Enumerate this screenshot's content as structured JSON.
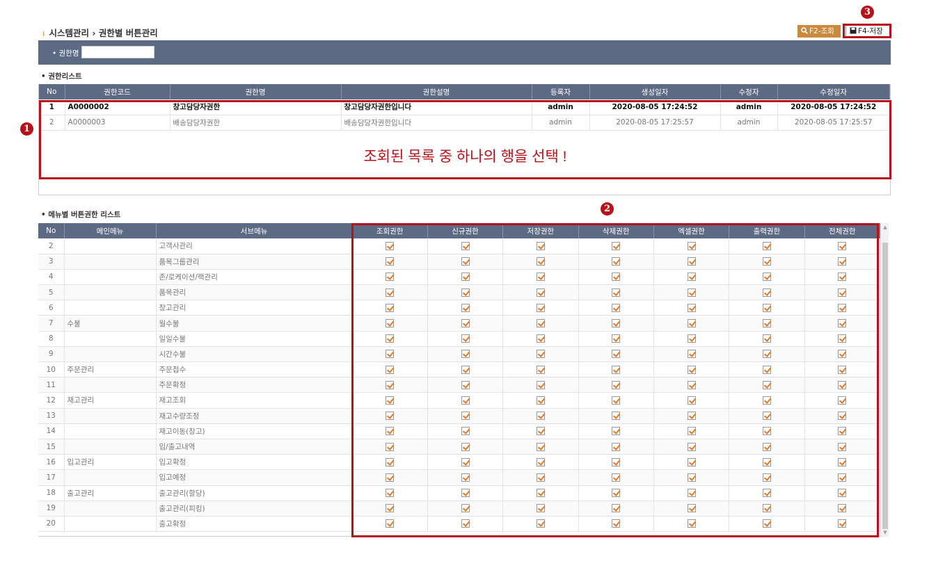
{
  "header": {
    "title_prefix": "시스템관리",
    "separator": "›",
    "title": "권한별 버튼관리",
    "search_button": "F2-조회",
    "save_button": "F4-저장"
  },
  "filter": {
    "label": "• 권한명",
    "value": ""
  },
  "roles_section": {
    "title": "• 권한리스트",
    "columns": [
      "No",
      "권한코드",
      "권한명",
      "권한설명",
      "등록자",
      "생성일자",
      "수정자",
      "수정일자"
    ],
    "rows": [
      {
        "no": "1",
        "code": "A0000002",
        "name": "창고담당자권한",
        "desc": "창고담당자권한입니다",
        "creator": "admin",
        "created": "2020-08-05 17:24:52",
        "modifier": "admin",
        "modified": "2020-08-05 17:24:52"
      },
      {
        "no": "2",
        "code": "A0000003",
        "name": "배송담당자권한",
        "desc": "배송담당자권한입니다",
        "creator": "admin",
        "created": "2020-08-05 17:25:57",
        "modifier": "admin",
        "modified": "2020-08-05 17:25:57"
      }
    ]
  },
  "menu_section": {
    "title": "• 메뉴별 버튼권한 리스트",
    "columns": [
      "No",
      "메인메뉴",
      "서브메뉴",
      "조회권한",
      "신규권한",
      "저장권한",
      "삭제권한",
      "엑셀권한",
      "출력권한",
      "전체권한"
    ],
    "rows": [
      {
        "no": "2",
        "main": "",
        "sub": "고객사관리"
      },
      {
        "no": "3",
        "main": "",
        "sub": "품목그룹관리"
      },
      {
        "no": "4",
        "main": "",
        "sub": "존/로케이션/랙관리"
      },
      {
        "no": "5",
        "main": "",
        "sub": "품목관리"
      },
      {
        "no": "6",
        "main": "",
        "sub": "창고관리"
      },
      {
        "no": "7",
        "main": "수불",
        "sub": "월수불"
      },
      {
        "no": "8",
        "main": "",
        "sub": "일일수불"
      },
      {
        "no": "9",
        "main": "",
        "sub": "시간수불"
      },
      {
        "no": "10",
        "main": "주문관리",
        "sub": "주문접수"
      },
      {
        "no": "11",
        "main": "",
        "sub": "주문확정"
      },
      {
        "no": "12",
        "main": "재고관리",
        "sub": "재고조회"
      },
      {
        "no": "13",
        "main": "",
        "sub": "재고수량조정"
      },
      {
        "no": "14",
        "main": "",
        "sub": "재고이동(창고)"
      },
      {
        "no": "15",
        "main": "",
        "sub": "입/출고내역"
      },
      {
        "no": "16",
        "main": "입고관리",
        "sub": "입고확정"
      },
      {
        "no": "17",
        "main": "",
        "sub": "입고예정"
      },
      {
        "no": "18",
        "main": "출고관리",
        "sub": "출고관리(할당)"
      },
      {
        "no": "19",
        "main": "",
        "sub": "출고관리(피킹)"
      },
      {
        "no": "20",
        "main": "",
        "sub": "출고확정"
      }
    ]
  },
  "annotations": {
    "marker1": "1",
    "marker2": "2",
    "marker3": "3",
    "instruction": "조회된 목록 중 하나의 행을 선택 !"
  },
  "colors": {
    "header_bg": "#5c6a83",
    "accent": "#c98a3f",
    "annotation": "#b5121b",
    "check": "#e8761f"
  }
}
